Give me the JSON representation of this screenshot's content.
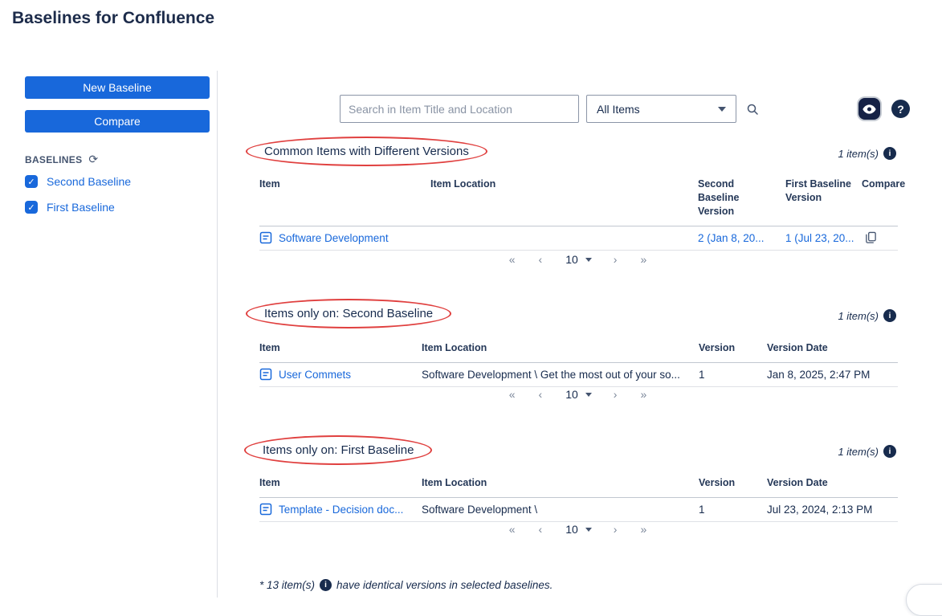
{
  "page": {
    "title": "Baselines for Confluence"
  },
  "icons": {
    "refresh": "⟳",
    "check": "✓",
    "question": "?",
    "info": "i"
  },
  "sidebar": {
    "new_baseline": "New Baseline",
    "compare": "Compare",
    "heading": "BASELINES",
    "baselines": [
      {
        "label": "Second Baseline",
        "checked": true
      },
      {
        "label": "First Baseline",
        "checked": true
      }
    ]
  },
  "toolbar": {
    "search_placeholder": "Search in Item Title and Location",
    "filter_value": "All Items"
  },
  "pagination": {
    "first": "«",
    "prev": "‹",
    "size": "10",
    "next": "›",
    "last": "»"
  },
  "sections": {
    "common": {
      "title": "Common Items with Different Versions",
      "count": "1 item(s)",
      "headers": {
        "item": "Item",
        "location": "Item Location",
        "second_version": "Second Baseline Version",
        "first_version": "First Baseline Version",
        "compare": "Compare"
      },
      "row": {
        "item": "Software Development",
        "location": "",
        "second_version": "2 (Jan 8, 20...",
        "first_version": "1 (Jul 23, 20..."
      }
    },
    "second_only": {
      "title": "Items only on: Second Baseline",
      "count": "1 item(s)",
      "headers": {
        "item": "Item",
        "location": "Item Location",
        "version": "Version",
        "date": "Version Date"
      },
      "row": {
        "item": "User Commets",
        "location": "Software Development \\ Get the most out of your so...",
        "version": "1",
        "date": "Jan 8, 2025, 2:47 PM"
      }
    },
    "first_only": {
      "title": "Items only on: First Baseline",
      "count": "1 item(s)",
      "headers": {
        "item": "Item",
        "location": "Item Location",
        "version": "Version",
        "date": "Version Date"
      },
      "row": {
        "item": "Template - Decision doc...",
        "location": "Software Development \\",
        "version": "1",
        "date": "Jul 23, 2024, 2:13 PM"
      }
    }
  },
  "footer": {
    "prefix": "* 13 item(s)",
    "suffix": "have identical versions in selected baselines."
  },
  "colors": {
    "accent": "#1868DB",
    "annotation": "#E0403F",
    "navy": "#172B4D"
  }
}
